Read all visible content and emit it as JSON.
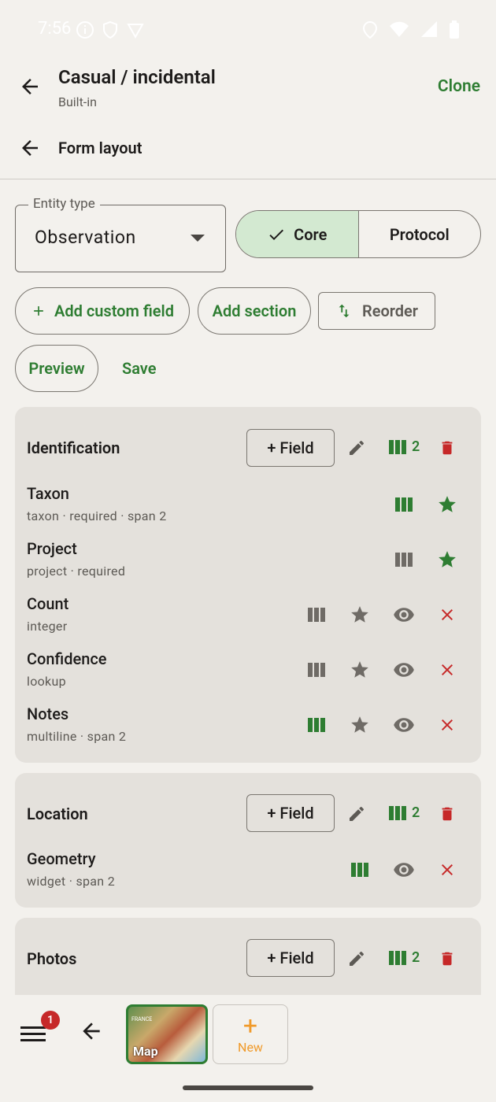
{
  "status": {
    "time": "7:56"
  },
  "appbar": {
    "title": "Casual / incidental",
    "subtitle": "Built-in",
    "clone_label": "Clone"
  },
  "subbar": {
    "title": "Form layout"
  },
  "entity": {
    "label": "Entity type",
    "value": "Observation"
  },
  "segments": {
    "core": "Core",
    "protocol": "Protocol",
    "selected": "core"
  },
  "actions": {
    "add_custom_field": "Add custom field",
    "add_section": "Add section",
    "reorder": "Reorder",
    "preview": "Preview",
    "save": "Save"
  },
  "sections": [
    {
      "title": "Identification",
      "field_btn": "+ Field",
      "span": "2",
      "rows": [
        {
          "title": "Taxon",
          "sub": "taxon · required · span 2"
        },
        {
          "title": "Project",
          "sub": "project · required"
        },
        {
          "title": "Count",
          "sub": "integer"
        },
        {
          "title": "Confidence",
          "sub": "lookup"
        },
        {
          "title": "Notes",
          "sub": "multiline · span 2"
        }
      ]
    },
    {
      "title": "Location",
      "field_btn": "+ Field",
      "span": "2",
      "rows": [
        {
          "title": "Geometry",
          "sub": "widget · span 2"
        }
      ]
    },
    {
      "title": "Photos",
      "field_btn": "+ Field",
      "span": "2",
      "rows": []
    }
  ],
  "bottom": {
    "badge": "1",
    "map_label": "Map",
    "map_small": "FRANCE",
    "new_label": "New"
  },
  "colors": {
    "accent": "#2e7d32",
    "danger": "#c62828",
    "new": "#f09a2a"
  }
}
